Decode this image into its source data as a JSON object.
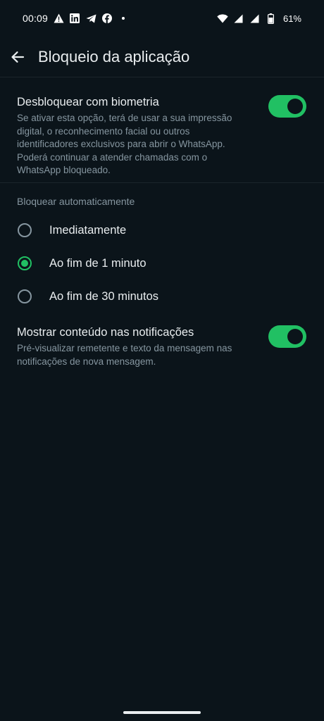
{
  "status_bar": {
    "time": "00:09",
    "battery_percent": "61%",
    "left_icons": [
      "alert-icon",
      "linkedin-icon",
      "telegram-icon",
      "facebook-icon",
      "dot-icon"
    ],
    "right_icons": [
      "wifi-icon",
      "signal-icon",
      "signal-icon-2",
      "battery-icon"
    ]
  },
  "header": {
    "title": "Bloqueio da aplicação",
    "back_icon": "arrow-left-icon"
  },
  "biometric": {
    "title": "Desbloquear com biometria",
    "description": "Se ativar esta opção, terá de usar a sua impressão digital, o reconhecimento facial ou outros identificadores exclusivos para abrir o WhatsApp. Poderá continuar a atender chamadas com o WhatsApp bloqueado.",
    "enabled": true
  },
  "auto_lock": {
    "header": "Bloquear automaticamente",
    "options": [
      {
        "label": "Imediatamente",
        "selected": false
      },
      {
        "label": "Ao fim de 1 minuto",
        "selected": true
      },
      {
        "label": "Ao fim de 30 minutos",
        "selected": false
      }
    ]
  },
  "notifications": {
    "title": "Mostrar conteúdo nas notificações",
    "description": "Pré-visualizar remetente e texto da mensagem nas notificações de nova mensagem.",
    "enabled": true
  },
  "colors": {
    "background": "#0b141a",
    "accent": "#21c063",
    "primary_text": "#e9edef",
    "secondary_text": "#8696a0"
  }
}
